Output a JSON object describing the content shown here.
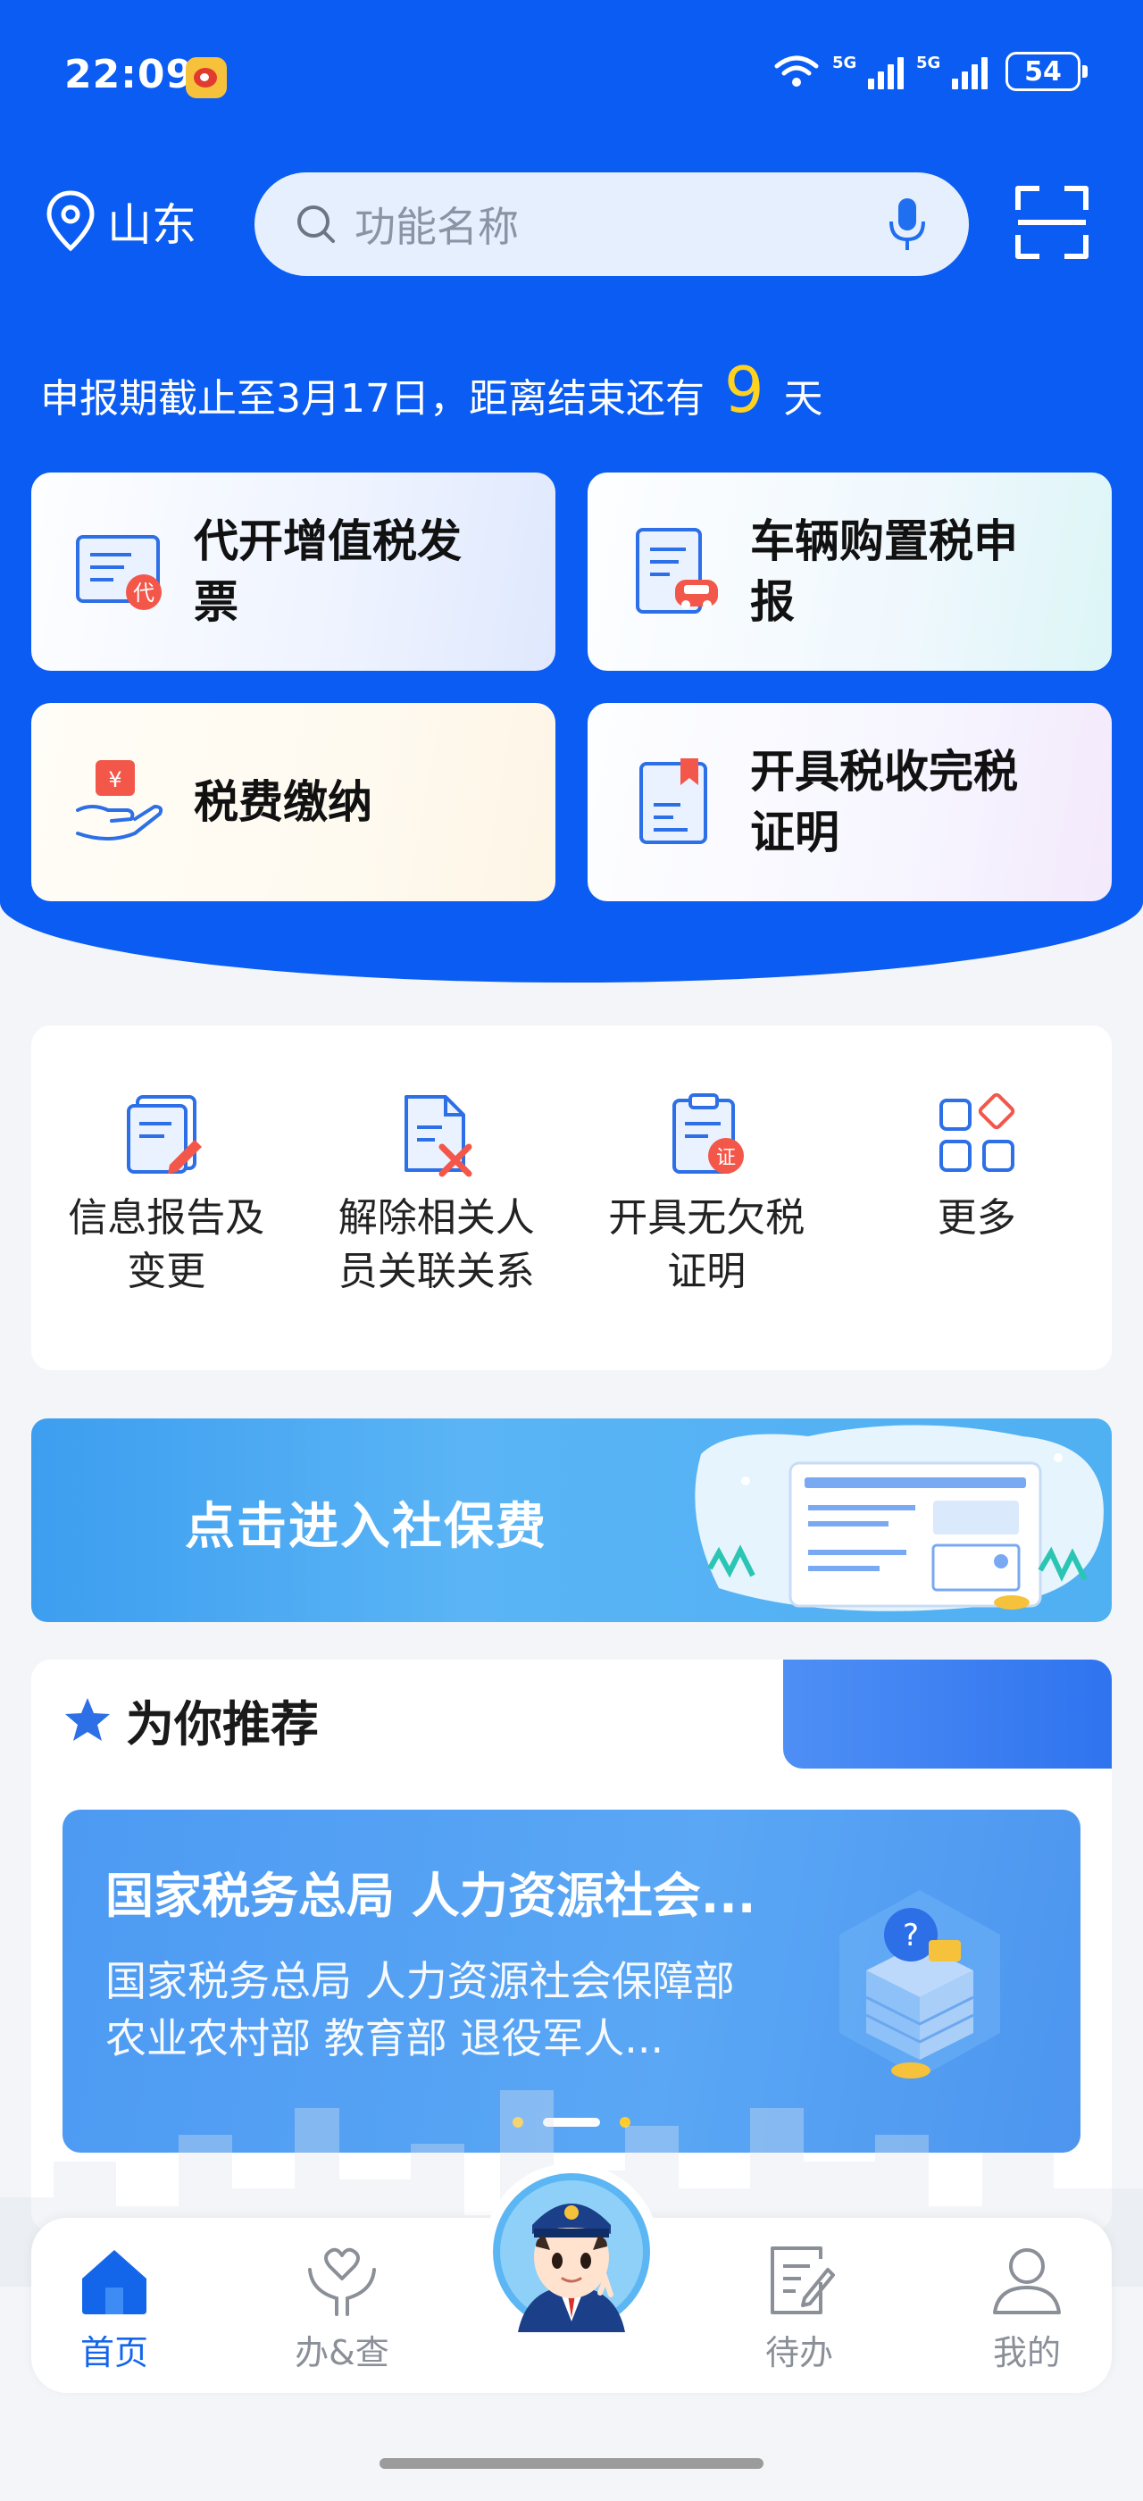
{
  "status_bar": {
    "time": "22:09",
    "network_1": "5G",
    "network_2": "5G",
    "battery": "54"
  },
  "header": {
    "location": "山东",
    "search_placeholder": "功能名称",
    "notice_prefix": "申报期截止至3月17日，距离结束还有",
    "notice_days": "9",
    "notice_suffix": "天"
  },
  "main_cards": [
    {
      "label": "代开增值税发票",
      "icon": "invoice-icon"
    },
    {
      "label": "车辆购置税申报",
      "icon": "vehicle-tax-icon"
    },
    {
      "label": "税费缴纳",
      "icon": "tax-payment-icon"
    },
    {
      "label": "开具税收完税证明",
      "icon": "tax-certificate-icon"
    }
  ],
  "quick_links": [
    {
      "label": "信息报告及变更",
      "icon": "info-report-icon"
    },
    {
      "label": "解除相关人员关联关系",
      "icon": "unlink-icon"
    },
    {
      "label": "开具无欠税证明",
      "icon": "no-arrears-certificate-icon"
    },
    {
      "label": "更多",
      "icon": "more-grid-icon"
    }
  ],
  "banner": {
    "text": "点击进入社保费"
  },
  "recommend": {
    "title": "为你推荐",
    "card_title": "国家税务总局 人力资源社会...",
    "card_desc": "国家税务总局 人力资源社会保障部 农业农村部 教育部 退役军人...",
    "dots": 3,
    "active_dot": 1
  },
  "tabbar": [
    {
      "label": "首页",
      "icon": "home-icon",
      "active": true
    },
    {
      "label": "办&查",
      "icon": "heart-hands-icon",
      "active": false
    },
    {
      "label": "待办",
      "icon": "todo-icon",
      "active": false
    },
    {
      "label": "我的",
      "icon": "user-icon",
      "active": false
    }
  ],
  "colors": {
    "brand_blue": "#0a5cf2",
    "highlight_yellow": "#ffd21f",
    "active_tab": "#1366ea"
  }
}
